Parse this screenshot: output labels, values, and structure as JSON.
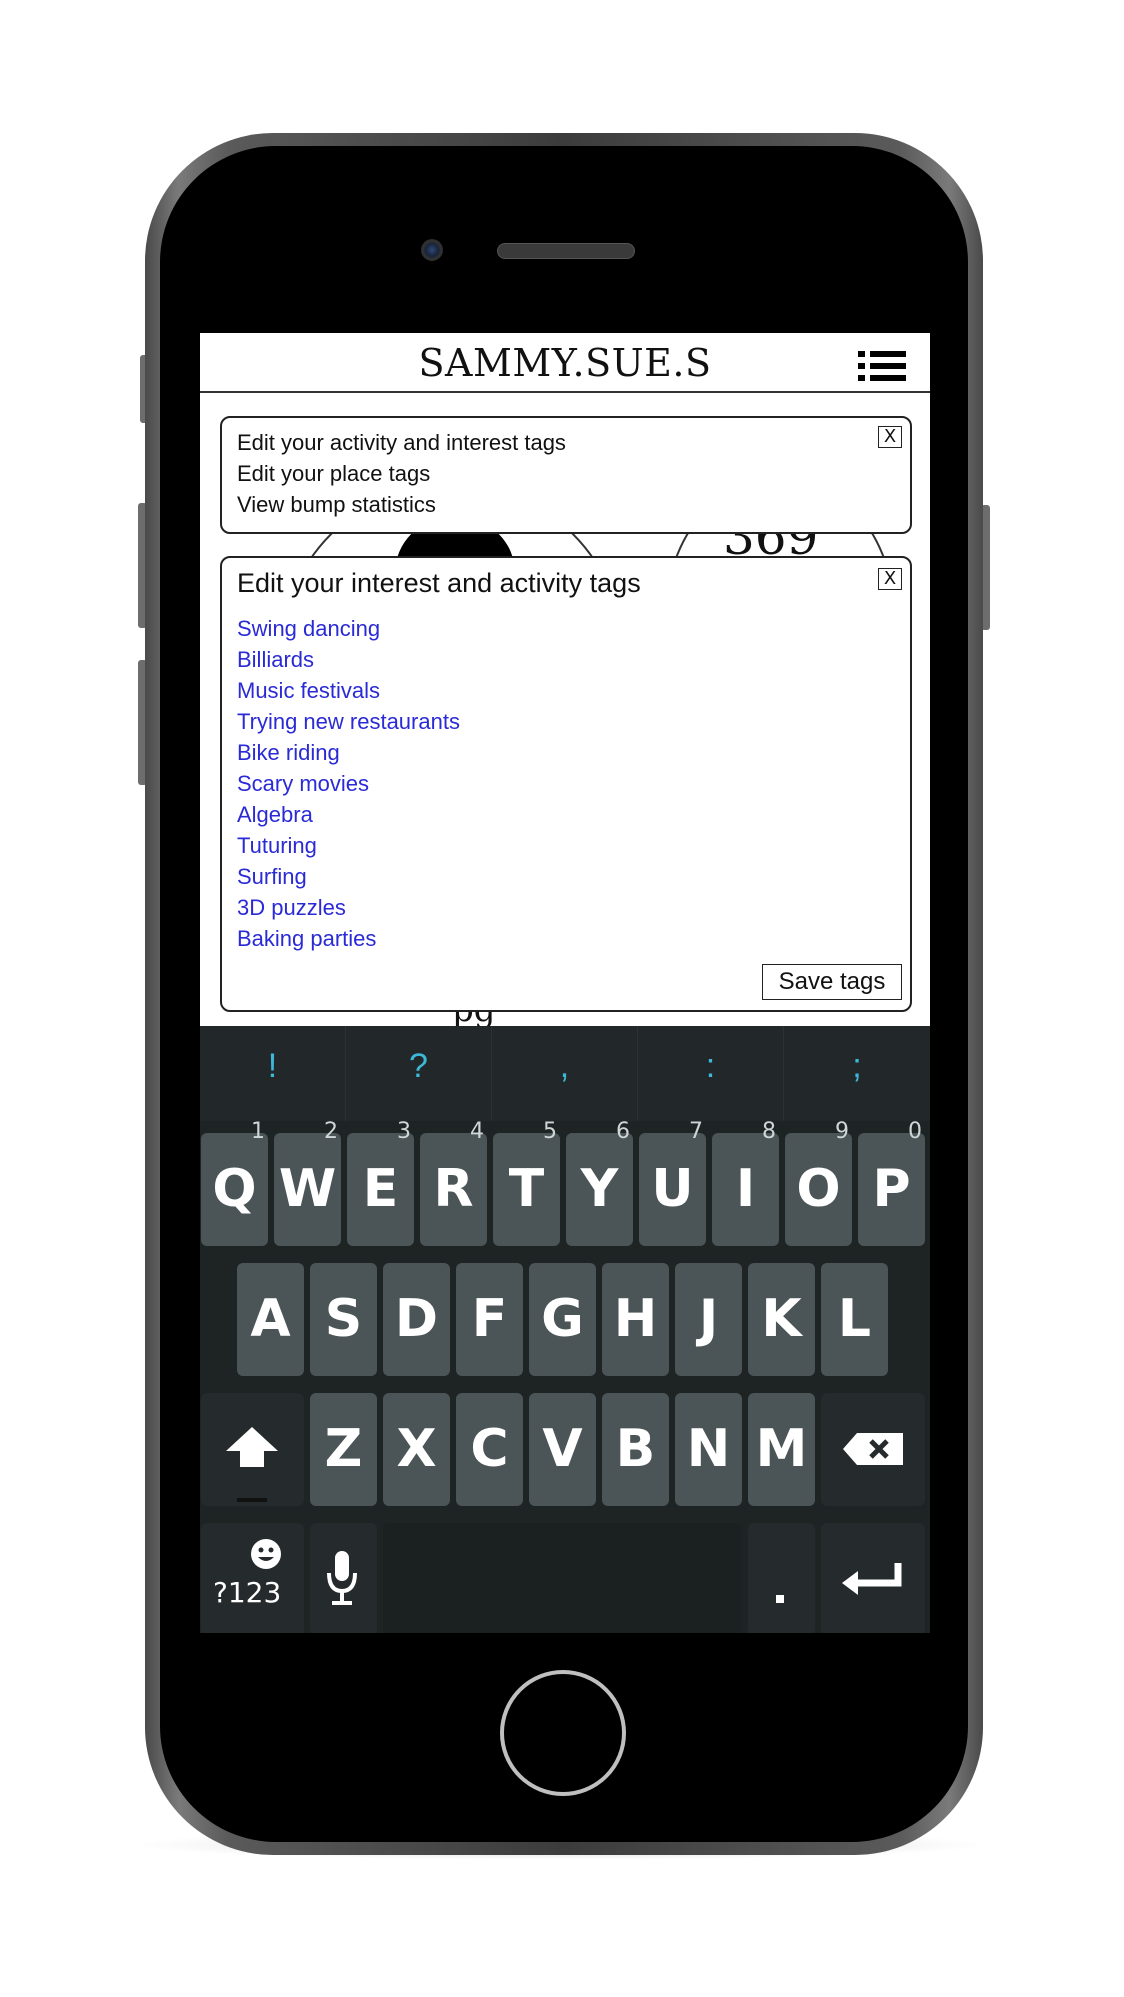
{
  "app": {
    "title": "SAMMY.SUE.S"
  },
  "background": {
    "number_fragment": "369",
    "text_fragment": "pg"
  },
  "menu": {
    "items": [
      "Edit your activity and interest tags",
      "Edit your place tags",
      "View bump statistics"
    ],
    "close_label": "X"
  },
  "tags_panel": {
    "title": "Edit your interest and activity tags",
    "close_label": "X",
    "tags": [
      "Swing dancing",
      "Billiards",
      "Music festivals",
      "Trying new restaurants",
      "Bike riding",
      "Scary movies",
      "Algebra",
      "Tuturing",
      "Surfing",
      "3D puzzles",
      "Baking parties"
    ],
    "save_label": "Save tags",
    "link_color": "#2a2ad6"
  },
  "keyboard": {
    "symbols": [
      "!",
      "?",
      ",",
      ":",
      ";"
    ],
    "row1": [
      {
        "key": "Q",
        "num": "1"
      },
      {
        "key": "W",
        "num": "2"
      },
      {
        "key": "E",
        "num": "3"
      },
      {
        "key": "R",
        "num": "4"
      },
      {
        "key": "T",
        "num": "5"
      },
      {
        "key": "Y",
        "num": "6"
      },
      {
        "key": "U",
        "num": "7"
      },
      {
        "key": "I",
        "num": "8"
      },
      {
        "key": "O",
        "num": "9"
      },
      {
        "key": "P",
        "num": "0"
      }
    ],
    "row2": [
      "A",
      "S",
      "D",
      "F",
      "G",
      "H",
      "J",
      "K",
      "L"
    ],
    "row3": [
      "Z",
      "X",
      "C",
      "V",
      "B",
      "N",
      "M"
    ],
    "mode_label": "?123",
    "accent_color": "#3db9d8"
  }
}
